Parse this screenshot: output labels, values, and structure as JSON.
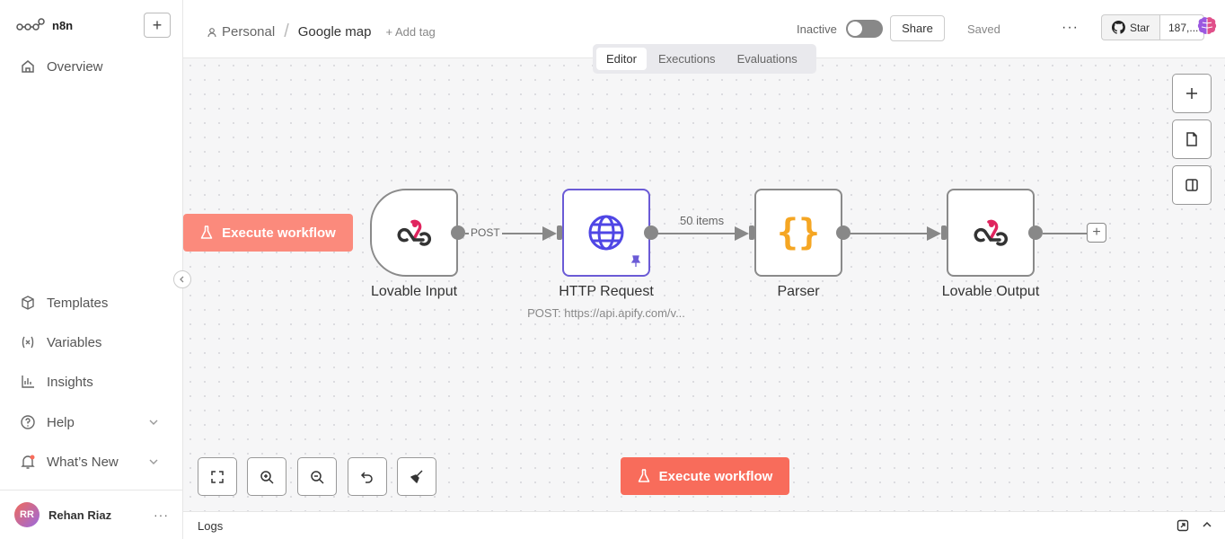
{
  "brand": {
    "name": "n8n",
    "new_button": "+"
  },
  "sidebar": {
    "top_items": [
      {
        "label": "Overview",
        "icon": "home-icon"
      }
    ],
    "bottom_items": [
      {
        "label": "Templates",
        "icon": "box-icon"
      },
      {
        "label": "Variables",
        "icon": "variables-icon"
      },
      {
        "label": "Insights",
        "icon": "bar-chart-icon"
      },
      {
        "label": "Help",
        "icon": "help-icon"
      },
      {
        "label": "What’s New",
        "icon": "bell-icon"
      }
    ],
    "user": {
      "initials": "RR",
      "name": "Rehan Riaz",
      "menu": "···"
    }
  },
  "header": {
    "project": "Personal",
    "workflow_name": "Google map",
    "add_tag": "+ Add tag",
    "status_label": "Inactive",
    "active": false,
    "share_label": "Share",
    "save_state": "Saved",
    "more": "···",
    "github_star": "Star",
    "github_count": "187,..."
  },
  "tabs": [
    {
      "label": "Editor",
      "active": true
    },
    {
      "label": "Executions",
      "active": false
    },
    {
      "label": "Evaluations",
      "active": false
    }
  ],
  "workflow": {
    "nodes": [
      {
        "name": "Lovable Input",
        "icon": "webhook-icon"
      },
      {
        "name": "HTTP Request",
        "icon": "globe-icon",
        "subtitle": "POST: https://api.apify.com/v...",
        "pinned": true
      },
      {
        "name": "Parser",
        "icon": "braces-icon"
      },
      {
        "name": "Lovable Output",
        "icon": "webhook-icon"
      }
    ],
    "edge_labels": [
      "POST",
      "50 items"
    ]
  },
  "canvas": {
    "execute_label": "Execute workflow",
    "execute_label_side": "Execute workflow"
  },
  "logs": {
    "label": "Logs"
  },
  "colors": {
    "accent": "#f86c5b",
    "selected": "#6b5bd6",
    "webhook": "#e0245e",
    "globe": "#4f46e5",
    "braces": "#f5a623"
  }
}
